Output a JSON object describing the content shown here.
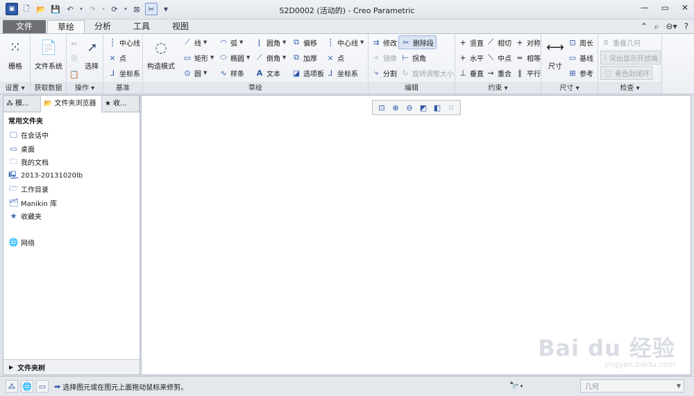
{
  "window": {
    "title": "S2D0002 (活动的) - Creo Parametric"
  },
  "tabs": [
    {
      "label": "文件"
    },
    {
      "label": "草绘"
    },
    {
      "label": "分析"
    },
    {
      "label": "工具"
    },
    {
      "label": "视图"
    }
  ],
  "ribbon": {
    "settings": {
      "grid": "栅格",
      "group": "设置"
    },
    "getdata": {
      "filesystem": "文件系统",
      "group": "获取数据"
    },
    "operations": {
      "select": "选择",
      "group": "操作"
    },
    "datum": {
      "centerline": "中心线",
      "point": "点",
      "csys": "坐标系",
      "group": "基准"
    },
    "sketch": {
      "construction": "构造模式",
      "line": "线",
      "arc": "弧",
      "fillet": "圆角",
      "offset": "偏移",
      "centerline": "中心线",
      "rectangle": "矩形",
      "ellipse": "椭圆",
      "chamfer": "倒角",
      "thicken": "加厚",
      "point": "点",
      "circle": "圆",
      "spline": "样条",
      "text": "文本",
      "palette": "选项板",
      "csys": "坐标系",
      "group": "草绘"
    },
    "editing": {
      "modify": "修改",
      "delete_segment": "删除段",
      "mirror": "镜像",
      "corner": "拐角",
      "divide": "分割",
      "rotate_resize": "旋转调整大小",
      "group": "编辑"
    },
    "constrain": {
      "vertical": "竖直",
      "tangent": "相切",
      "symmetric": "对称",
      "horizontal": "水平",
      "midpoint": "中点",
      "equal": "相等",
      "perpendicular": "垂直",
      "coincident": "重合",
      "parallel": "平行",
      "group": "约束"
    },
    "dimension": {
      "dimension": "尺寸",
      "perimeter": "周长",
      "baseline": "基线",
      "reference": "参考",
      "group": "尺寸"
    },
    "inspect": {
      "overlap": "重叠几何",
      "highlight_open": "突出显示开放端",
      "shade_closed": "着色封闭环",
      "group": "检查"
    }
  },
  "left_panel": {
    "tabs": [
      {
        "label": "模..."
      },
      {
        "label": "文件夹浏览器"
      },
      {
        "label": "收..."
      }
    ],
    "section": "常用文件夹",
    "items": [
      {
        "label": "在会话中",
        "icon": "monitor-icon"
      },
      {
        "label": "桌面",
        "icon": "desktop-icon"
      },
      {
        "label": "我的文档",
        "icon": "documents-icon"
      },
      {
        "label": "2013-20131020lb",
        "icon": "computer-icon"
      },
      {
        "label": "工作目录",
        "icon": "work-folder-icon"
      },
      {
        "label": "Manikin 库",
        "icon": "manikin-library-icon"
      },
      {
        "label": "收藏夹",
        "icon": "favorites-icon"
      },
      {
        "label": "网络",
        "icon": "network-icon"
      }
    ],
    "footer": "文件夹树"
  },
  "watermark": {
    "brand": "Bai du 经验",
    "url": "jingyan.baidu.com"
  },
  "status": {
    "message": "选择图元或在图元上面拖动鼠标来修剪。",
    "filter": "几何"
  }
}
